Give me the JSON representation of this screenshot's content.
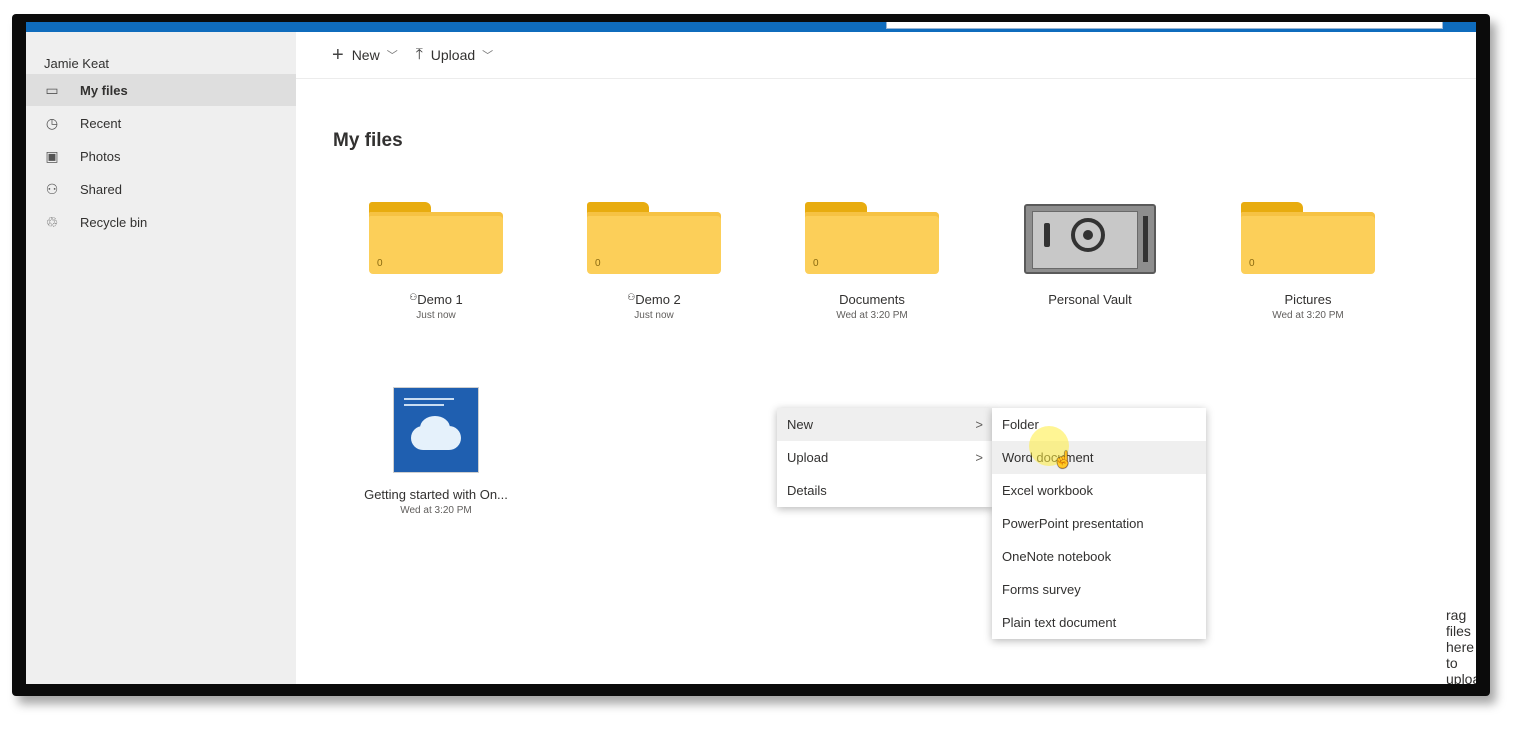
{
  "sidebar": {
    "user_name": "Jamie Keat",
    "items": [
      {
        "label": "My files",
        "icon": "folder-icon",
        "glyph": "▭",
        "active": true
      },
      {
        "label": "Recent",
        "icon": "clock-icon",
        "glyph": "◷",
        "active": false
      },
      {
        "label": "Photos",
        "icon": "photo-icon",
        "glyph": "▣",
        "active": false
      },
      {
        "label": "Shared",
        "icon": "shared-icon",
        "glyph": "⚇",
        "active": false
      },
      {
        "label": "Recycle bin",
        "icon": "recycle-bin-icon",
        "glyph": "♲",
        "active": false
      }
    ]
  },
  "command_bar": {
    "new_label": "New",
    "upload_label": "Upload"
  },
  "main": {
    "title": "My files",
    "drag_hint": "rag files here to upload"
  },
  "tiles": [
    {
      "kind": "folder",
      "name": "Demo 1",
      "sub": "Just now",
      "count": "0",
      "shared": true
    },
    {
      "kind": "folder",
      "name": "Demo 2",
      "sub": "Just now",
      "count": "0",
      "shared": true
    },
    {
      "kind": "folder",
      "name": "Documents",
      "sub": "Wed at 3:20 PM",
      "count": "0",
      "shared": false
    },
    {
      "kind": "vault",
      "name": "Personal Vault",
      "sub": "",
      "count": "",
      "shared": false
    },
    {
      "kind": "folder",
      "name": "Pictures",
      "sub": "Wed at 3:20 PM",
      "count": "0",
      "shared": false
    },
    {
      "kind": "document",
      "name": "Getting started with On...",
      "sub": "Wed at 3:20 PM",
      "count": "",
      "shared": false
    }
  ],
  "context_menu": {
    "items": [
      {
        "label": "New",
        "submenu": true
      },
      {
        "label": "Upload",
        "submenu": true
      },
      {
        "label": "Details",
        "submenu": false
      }
    ]
  },
  "new_submenu": {
    "items": [
      {
        "label": "Folder"
      },
      {
        "label": "Word document"
      },
      {
        "label": "Excel workbook"
      },
      {
        "label": "PowerPoint presentation"
      },
      {
        "label": "OneNote notebook"
      },
      {
        "label": "Forms survey"
      },
      {
        "label": "Plain text document"
      }
    ]
  },
  "colors": {
    "accent": "#0f6cbd",
    "folder": "#fccf59",
    "folder_tab": "#e8ac0f",
    "sidebar_bg": "#efefef"
  }
}
